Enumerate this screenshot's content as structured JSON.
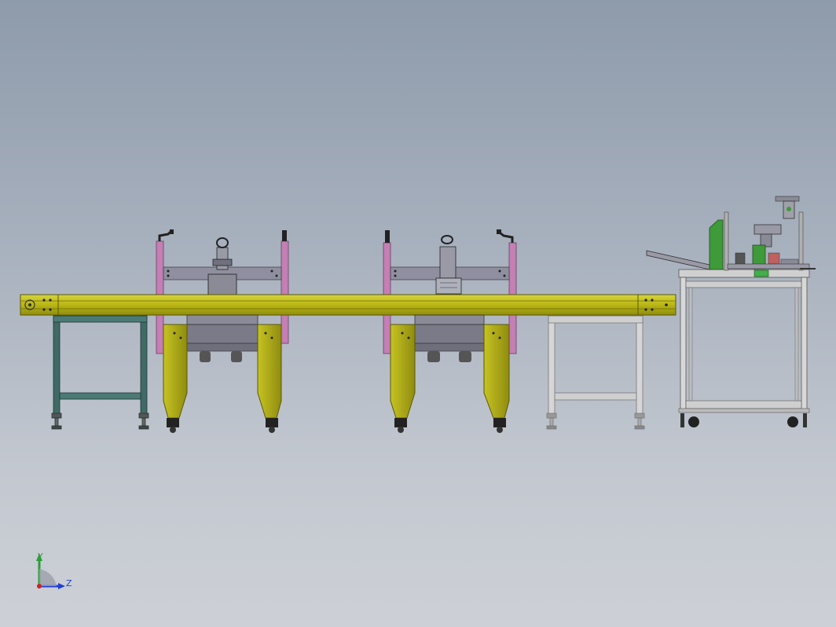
{
  "triad": {
    "y_label": "Y",
    "z_label": "Z",
    "colors": {
      "y": "#2e9e3a",
      "z": "#1f3fd6",
      "x": "#d02020"
    }
  },
  "palette": {
    "conveyor_yellow": "#b9b614",
    "press_yellow": "#a8a51a",
    "pink_post": "#c47fb4",
    "dark_stand": "#3f6a66",
    "light_stand": "#c8c8c8",
    "feeder_green": "#3f9a3a"
  }
}
